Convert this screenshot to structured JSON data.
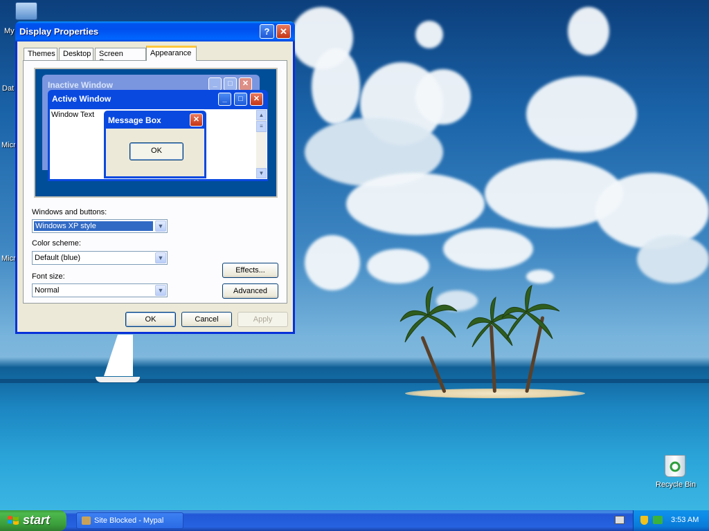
{
  "desktop": {
    "icons": [
      {
        "label": "My",
        "name": "my-computer-icon"
      },
      {
        "label": "Dat",
        "name": "database-icon"
      },
      {
        "label": "Micro",
        "name": "microsoft-app-icon"
      },
      {
        "label": "Micro",
        "name": "microsoft-app-icon-2"
      }
    ],
    "recycle_bin_label": "Recycle Bin"
  },
  "dialog": {
    "title": "Display Properties",
    "help_label": "?",
    "close_label": "✕",
    "tabs": [
      "Themes",
      "Desktop",
      "Screen Saver",
      "Appearance"
    ],
    "active_tab": "Appearance",
    "preview": {
      "inactive_title": "Inactive Window",
      "active_title": "Active Window",
      "window_text": "Window Text",
      "message_box_title": "Message Box",
      "message_box_ok": "OK"
    },
    "windows_buttons_label": "Windows and buttons:",
    "windows_buttons_value": "Windows XP style",
    "color_scheme_label": "Color scheme:",
    "color_scheme_value": "Default (blue)",
    "font_size_label": "Font size:",
    "font_size_value": "Normal",
    "effects_label": "Effects...",
    "advanced_label": "Advanced",
    "ok_label": "OK",
    "cancel_label": "Cancel",
    "apply_label": "Apply"
  },
  "taskbar": {
    "start_label": "start",
    "task_item_label": "Site Blocked - Mypal",
    "clock": "3:53 AM"
  },
  "colors": {
    "xp_blue": "#0053ee",
    "dialog_face": "#ece9d8",
    "start_green": "#3c9b3c",
    "tray_blue": "#0d8ee9"
  }
}
